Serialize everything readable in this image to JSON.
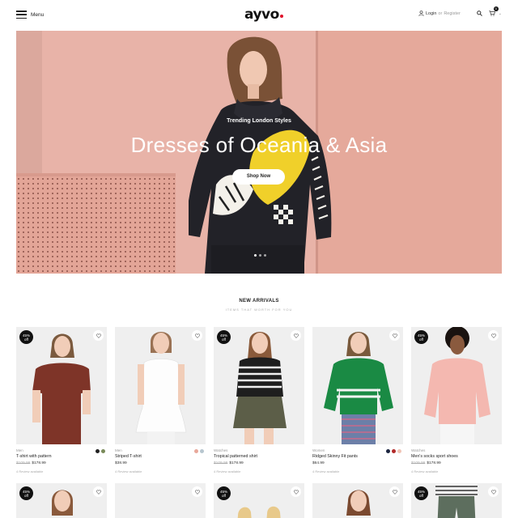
{
  "header": {
    "menu_label": "Menu",
    "logo_text": "ayvo",
    "logo_dot_color": "#e0122b",
    "login_label": "Login",
    "or_label": "or",
    "register_label": "Register",
    "cart_count": "0"
  },
  "hero": {
    "kicker": "Trending London Styles",
    "title": "Dresses of Oceania & Asia",
    "button_label": "Shop Now",
    "slides": 3,
    "active_slide": 1
  },
  "section": {
    "title": "NEW ARRIVALS",
    "subtitle": "ITEMS THAT WORTH FOR YOU"
  },
  "products": [
    {
      "badge": "45% off",
      "category": "Men",
      "name": "T-shirt with pattern",
      "old_price": "$109.99",
      "price": "$178.99",
      "reviews": "4 Review available",
      "swatches": [
        "#222222",
        "#7a8b5a"
      ]
    },
    {
      "badge": "",
      "category": "Men",
      "name": "Striped T-shirt",
      "old_price": "",
      "price": "$38.99",
      "reviews": "4 Review available",
      "swatches": [
        "#e8a89a",
        "#b7c6cf"
      ]
    },
    {
      "badge": "45% off",
      "category": "Watches",
      "name": "Tropical patterned shirt",
      "old_price": "$109.99",
      "price": "$178.99",
      "reviews": "4 Review available",
      "swatches": []
    },
    {
      "badge": "",
      "category": "Women",
      "name": "Ridged Skinny Fit pants",
      "old_price": "",
      "price": "$64.99",
      "reviews": "4 Review available",
      "swatches": [
        "#1c2540",
        "#b22a2a",
        "#f0c4b6"
      ]
    },
    {
      "badge": "45% off",
      "category": "Watches",
      "name": "Men's socks sport shoes",
      "old_price": "$109.99",
      "price": "$178.99",
      "reviews": "4 Review available",
      "swatches": []
    }
  ],
  "products_row2_badges": [
    "45% off",
    "",
    "45% off",
    "",
    "45% off"
  ]
}
